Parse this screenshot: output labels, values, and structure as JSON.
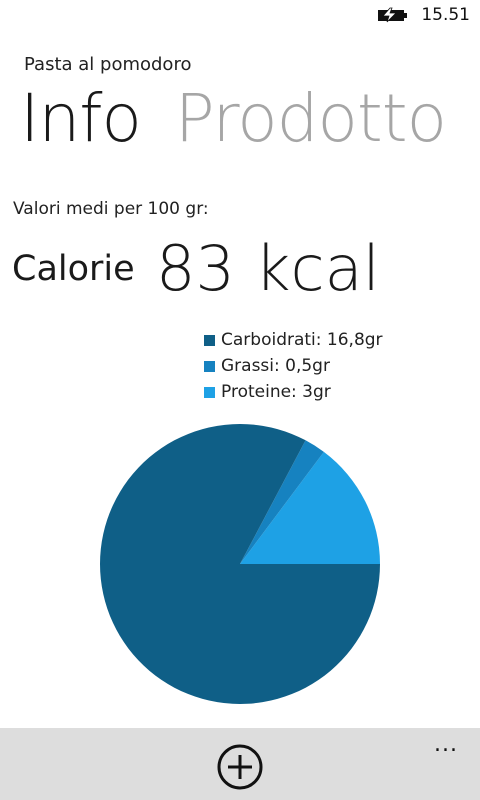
{
  "status_bar": {
    "time": "15.51",
    "battery_icon": "battery-charging-icon"
  },
  "header": {
    "app_title": "Pasta al pomodoro",
    "pivot_items": [
      {
        "label": "Info",
        "active": true
      },
      {
        "label": "Prodotto",
        "active": false
      }
    ]
  },
  "main": {
    "subtitle": "Valori medi per 100 gr:",
    "calorie_label": "Calorie",
    "calorie_value": "83 kcal"
  },
  "chart_data": {
    "type": "pie",
    "series": [
      {
        "name": "Carboidrati",
        "value": 16.8,
        "label": "Carboidrati: 16,8gr",
        "color": "#0f5f87"
      },
      {
        "name": "Grassi",
        "value": 0.5,
        "label": "Grassi: 0,5gr",
        "color": "#1682c0"
      },
      {
        "name": "Proteine",
        "value": 3,
        "label": "Proteine: 3gr",
        "color": "#1ea1e5"
      }
    ],
    "legend_position": "top"
  },
  "app_bar": {
    "add_icon": "add-circle-icon",
    "more_label": "..."
  },
  "colors": {
    "background": "#ffffff",
    "app_bar": "#dddddd",
    "pivot_inactive": "#a6a6a6"
  }
}
